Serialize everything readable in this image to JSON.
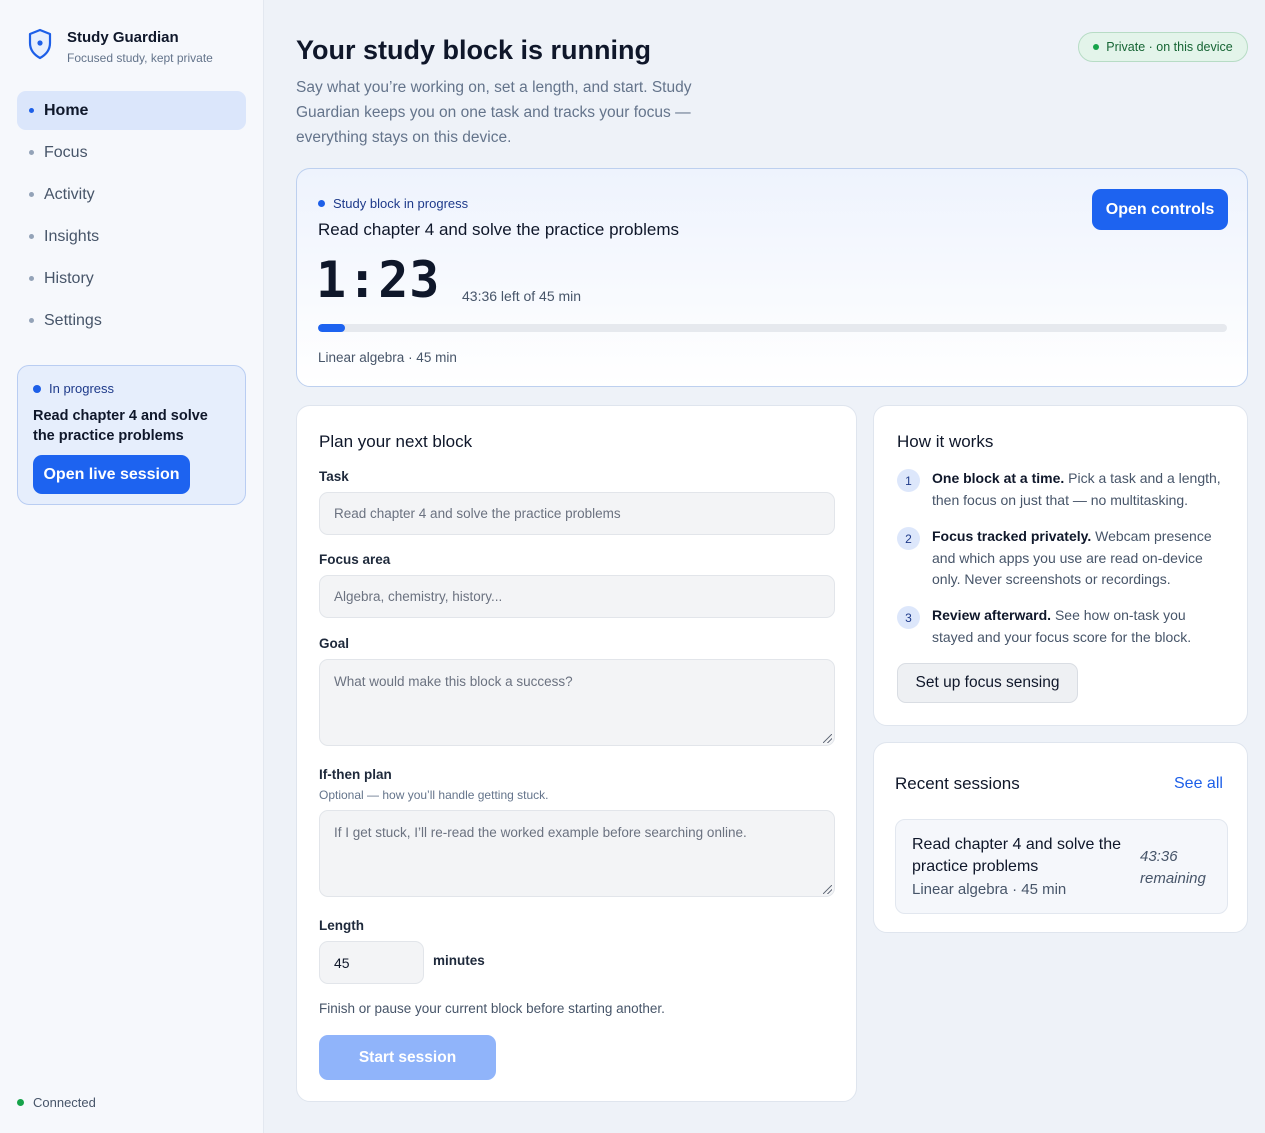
{
  "app": {
    "name": "Study Guardian",
    "tagline": "Focused study, kept private"
  },
  "sidebar": {
    "items": [
      {
        "label": "Home",
        "active": true
      },
      {
        "label": "Focus"
      },
      {
        "label": "Activity"
      },
      {
        "label": "Insights"
      },
      {
        "label": "History"
      },
      {
        "label": "Settings"
      }
    ],
    "progress_card": {
      "status": "In progress",
      "task": "Read chapter 4 and solve the practice problems",
      "button": "Open live session"
    },
    "connection": "Connected"
  },
  "header": {
    "title": "Your study block is running",
    "subtitle": "Say what you’re working on, set a length, and start. Study Guardian keeps you on one task and tracks your focus — everything stays on this device.",
    "privacy_badge": "Private · on this device"
  },
  "live_session": {
    "status": "Study block in progress",
    "task": "Read chapter 4 and solve the practice problems",
    "elapsed": "1:23",
    "remaining_text": "43:36 left of 45 min",
    "progress_fraction": 0.03,
    "meta": "Linear algebra · 45 min",
    "button": "Open controls"
  },
  "plan": {
    "title": "Plan your next block",
    "task_label": "Task",
    "task_value": "Read chapter 4 and solve the practice problems",
    "focus_label": "Focus area",
    "focus_placeholder": "Algebra, chemistry, history...",
    "goal_label": "Goal",
    "goal_placeholder": "What would make this block a success?",
    "ifthen_label": "If-then plan",
    "ifthen_hint": "Optional — how you’ll handle getting stuck.",
    "ifthen_placeholder": "If I get stuck, I’ll re-read the worked example before searching online.",
    "length_label": "Length",
    "length_value": "45",
    "length_unit": "minutes",
    "note": "Finish or pause your current block before starting another.",
    "start_button": "Start session"
  },
  "how_it_works": {
    "title": "How it works",
    "steps": [
      {
        "num": "1",
        "bold": "One block at a time.",
        "text": " Pick a task and a length, then focus on just that — no multitasking."
      },
      {
        "num": "2",
        "bold": "Focus tracked privately.",
        "text": " Webcam presence and which apps you use are read on-device only. Never screenshots or recordings."
      },
      {
        "num": "3",
        "bold": "Review afterward.",
        "text": " See how on-task you stayed and your focus score for the block."
      }
    ],
    "button": "Set up focus sensing"
  },
  "recent": {
    "title": "Recent sessions",
    "see_all": "See all",
    "sessions": [
      {
        "task": "Read chapter 4 and solve the practice problems",
        "meta": "Linear algebra · 45 min",
        "remaining": "43:36 remaining"
      }
    ]
  },
  "colors": {
    "accent": "#1d63f0",
    "success": "#16a34a",
    "background": "#eef2f8"
  }
}
